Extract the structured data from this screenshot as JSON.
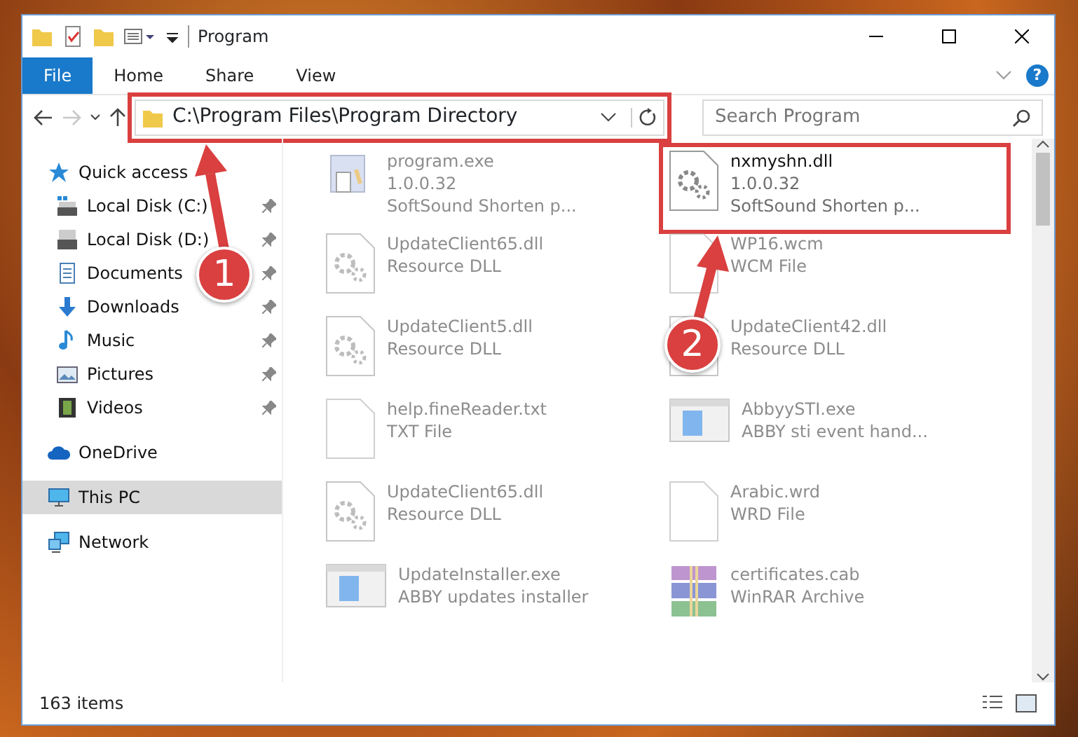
{
  "window": {
    "title": "Program",
    "help": "?"
  },
  "ribbon_tabs": [
    {
      "label": "File",
      "selected": true
    },
    {
      "label": "Home",
      "selected": false
    },
    {
      "label": "Share",
      "selected": false
    },
    {
      "label": "View",
      "selected": false
    }
  ],
  "address": {
    "path": "C:\\Program Files\\Program Directory",
    "forward_disabled": true,
    "highlighted": true
  },
  "search": {
    "placeholder": "Search Program"
  },
  "sidebar": [
    {
      "label": "Quick access",
      "kind": "star",
      "selected": false,
      "children": [
        {
          "label": "Local Disk (C:)",
          "kind": "drive-c",
          "pinned": true,
          "selected": false
        },
        {
          "label": "Local Disk (D:)",
          "kind": "drive",
          "pinned": true,
          "selected": false
        },
        {
          "label": "Documents",
          "kind": "documents",
          "pinned": true,
          "selected": false
        },
        {
          "label": "Downloads",
          "kind": "downloads",
          "pinned": true,
          "selected": false
        },
        {
          "label": "Music",
          "kind": "music",
          "pinned": true,
          "selected": false
        },
        {
          "label": "Pictures",
          "kind": "pictures",
          "pinned": true,
          "selected": false
        },
        {
          "label": "Videos",
          "kind": "videos",
          "pinned": true,
          "selected": false
        }
      ]
    },
    {
      "label": "OneDrive",
      "kind": "cloud",
      "selected": false
    },
    {
      "label": "This PC",
      "kind": "pc",
      "selected": true
    },
    {
      "label": "Network",
      "kind": "network",
      "selected": false
    }
  ],
  "files": [
    {
      "name": "program.exe",
      "lines": [
        "1.0.0.32",
        "SoftSound Shorten p..."
      ],
      "kind": "exe",
      "faded": true,
      "highlighted": false
    },
    {
      "name": "nxmyshn.dll",
      "lines": [
        "1.0.0.32",
        "SoftSound Shorten p..."
      ],
      "kind": "dll",
      "faded": false,
      "highlighted": true
    },
    {
      "name": "UpdateClient65.dll",
      "lines": [
        "Resource DLL"
      ],
      "kind": "dll",
      "faded": true,
      "highlighted": false
    },
    {
      "name": "WP16.wcm",
      "lines": [
        "WCM File"
      ],
      "kind": "blank",
      "faded": true,
      "highlighted": false
    },
    {
      "name": "UpdateClient5.dll",
      "lines": [
        "Resource DLL"
      ],
      "kind": "dll",
      "faded": true,
      "highlighted": false
    },
    {
      "name": "UpdateClient42.dll",
      "lines": [
        "Resource DLL"
      ],
      "kind": "dll",
      "faded": true,
      "highlighted": false
    },
    {
      "name": "help.fineReader.txt",
      "lines": [
        "TXT File"
      ],
      "kind": "blank",
      "faded": true,
      "highlighted": false
    },
    {
      "name": "AbbyySTI.exe",
      "lines": [
        "ABBY sti event hand..."
      ],
      "kind": "app",
      "faded": true,
      "highlighted": false
    },
    {
      "name": "UpdateClient65.dll",
      "lines": [
        "Resource DLL"
      ],
      "kind": "dll",
      "faded": true,
      "highlighted": false
    },
    {
      "name": "Arabic.wrd",
      "lines": [
        "WRD File"
      ],
      "kind": "blank",
      "faded": true,
      "highlighted": false
    },
    {
      "name": "UpdateInstaller.exe",
      "lines": [
        "ABBY updates installer"
      ],
      "kind": "app",
      "faded": true,
      "highlighted": false
    },
    {
      "name": "certificates.cab",
      "lines": [
        "WinRAR Archive"
      ],
      "kind": "archive",
      "faded": true,
      "highlighted": false
    }
  ],
  "status_bar": {
    "count": "163 items"
  },
  "callouts": [
    {
      "number": "1"
    },
    {
      "number": "2"
    }
  ]
}
